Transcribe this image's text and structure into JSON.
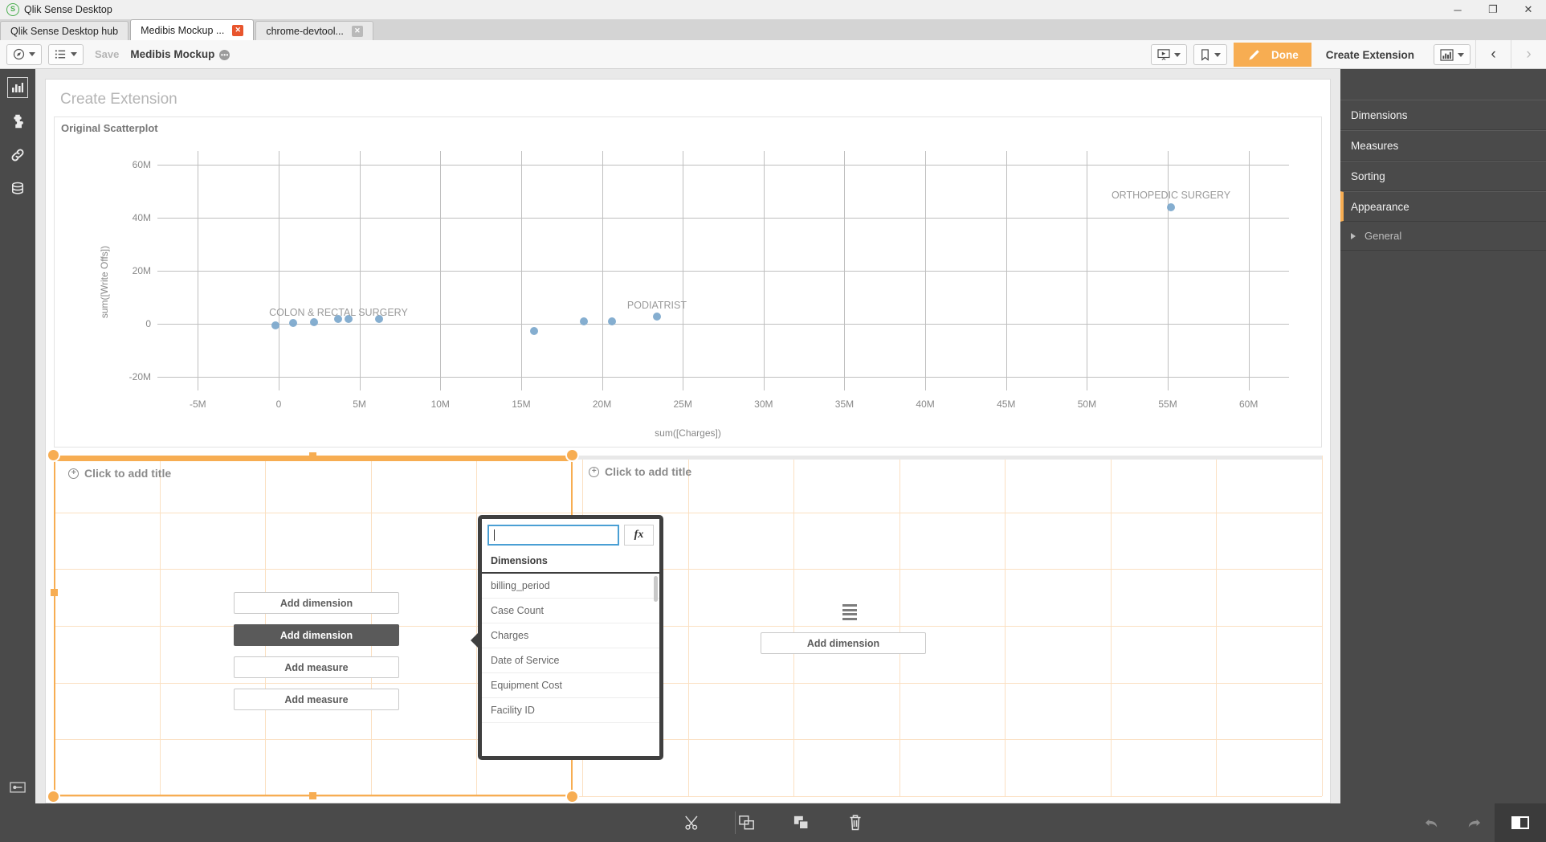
{
  "window": {
    "app_title": "Qlik Sense Desktop",
    "app_icon": "qlik-logo-icon",
    "minimize": "─",
    "maximize": "❐",
    "close": "✕"
  },
  "tabs": [
    {
      "label": "Qlik Sense Desktop hub",
      "active": false,
      "closable": false
    },
    {
      "label": "Medibis Mockup ...",
      "active": true,
      "closable": true,
      "close_glyph": "✕"
    },
    {
      "label": "chrome-devtool...",
      "active": false,
      "closable": true,
      "close_glyph": "✕"
    }
  ],
  "toolbar": {
    "nav_icon": "compass-icon",
    "sheets_icon": "sheet-list-icon",
    "save_label": "Save",
    "doc_title": "Medibis Mockup",
    "doc_badge": "•••",
    "storytelling_icon": "storytelling-icon",
    "bookmark_icon": "bookmark-icon",
    "edit_icon": "pencil-icon",
    "done_label": "Done",
    "extension_name": "Create Extension",
    "chart_type_icon": "bar-chart-icon",
    "prev_glyph": "‹",
    "next_glyph": "›"
  },
  "rail": {
    "items": [
      {
        "icon": "charts-icon",
        "glyph": "▐▐",
        "selected": true
      },
      {
        "icon": "puzzle-piece-icon",
        "glyph": "❖",
        "selected": false
      },
      {
        "icon": "link-icon",
        "glyph": "⚭",
        "selected": false
      },
      {
        "icon": "database-icon",
        "glyph": "⌸",
        "selected": false
      }
    ],
    "bottom_icon": "key-field-icon"
  },
  "property_panel": {
    "items": [
      {
        "label": "Dimensions",
        "selected": false
      },
      {
        "label": "Measures",
        "selected": false
      },
      {
        "label": "Sorting",
        "selected": false
      },
      {
        "label": "Appearance",
        "selected": true
      }
    ],
    "sub_items": [
      {
        "label": "General",
        "expander_icon": "triangle-right-icon"
      }
    ],
    "accent_color": "#f7ad52"
  },
  "sheet": {
    "title": "Create Extension"
  },
  "chart_data": {
    "type": "scatter",
    "title": "Original Scatterplot",
    "xlabel": "sum([Charges])",
    "ylabel": "sum([Write Offs])",
    "xlim": [
      -7500000,
      62500000
    ],
    "ylim": [
      -25000000,
      65000000
    ],
    "xticks": [
      "-5M",
      "0",
      "5M",
      "10M",
      "15M",
      "20M",
      "25M",
      "30M",
      "35M",
      "40M",
      "45M",
      "50M",
      "55M",
      "60M"
    ],
    "xtick_values": [
      -5000000,
      0,
      5000000,
      10000000,
      15000000,
      20000000,
      25000000,
      30000000,
      35000000,
      40000000,
      45000000,
      50000000,
      55000000,
      60000000
    ],
    "yticks": [
      "60M",
      "40M",
      "20M",
      "0",
      "-20M"
    ],
    "ytick_values": [
      60000000,
      40000000,
      20000000,
      0,
      -20000000
    ],
    "grid": true,
    "legend": "none",
    "point_color": "#7ba7cc",
    "points": [
      {
        "x": -200000,
        "y": -500000
      },
      {
        "x": 900000,
        "y": 300000
      },
      {
        "x": 2200000,
        "y": 800000
      },
      {
        "x": 3700000,
        "y": 1900000
      },
      {
        "x": 4300000,
        "y": 1900000
      },
      {
        "x": 6200000,
        "y": 1900000
      },
      {
        "x": 15800000,
        "y": -2500000
      },
      {
        "x": 18900000,
        "y": 900000
      },
      {
        "x": 20600000,
        "y": 900000
      },
      {
        "x": 23400000,
        "y": 2800000
      },
      {
        "x": 55200000,
        "y": 44000000
      }
    ],
    "annotations": [
      {
        "text": "COLON & RECTAL SURGERY",
        "x": 3700000,
        "y": 6500000
      },
      {
        "text": "PODIATRIST",
        "x": 23400000,
        "y": 9000000
      },
      {
        "text": "ORTHOPEDIC SURGERY",
        "x": 55200000,
        "y": 50500000
      }
    ]
  },
  "authoring": {
    "left_cell": {
      "title": "Click to add title",
      "add_icon": "plus-circle-icon",
      "selected": true,
      "buttons": [
        {
          "label": "Add dimension",
          "kind": "dimension",
          "active": false
        },
        {
          "label": "Add dimension",
          "kind": "dimension",
          "active": true
        },
        {
          "label": "Add measure",
          "kind": "measure",
          "active": false
        },
        {
          "label": "Add measure",
          "kind": "measure",
          "active": false
        }
      ]
    },
    "right_cell": {
      "title": "Click to add title",
      "add_icon": "plus-circle-icon",
      "placeholder_icon": "table-icon",
      "buttons": [
        {
          "label": "Add dimension",
          "kind": "dimension",
          "active": false
        }
      ]
    }
  },
  "popup": {
    "search_value": "",
    "search_placeholder": "",
    "fx_label": "fx",
    "fx_icon": "expression-icon",
    "section_header": "Dimensions",
    "items": [
      {
        "label": "billing_period"
      },
      {
        "label": "Case Count"
      },
      {
        "label": "Charges"
      },
      {
        "label": "Date of Service"
      },
      {
        "label": "Equipment Cost"
      },
      {
        "label": "Facility ID"
      }
    ]
  },
  "bottom_bar": {
    "cut_icon": "scissors-icon",
    "copy_icon": "copy-icon",
    "paste_icon": "paste-icon",
    "delete_icon": "trash-icon",
    "undo_icon": "undo-arrow-icon",
    "redo_icon": "redo-arrow-icon",
    "panel_toggle_icon": "panel-toggle-icon"
  }
}
